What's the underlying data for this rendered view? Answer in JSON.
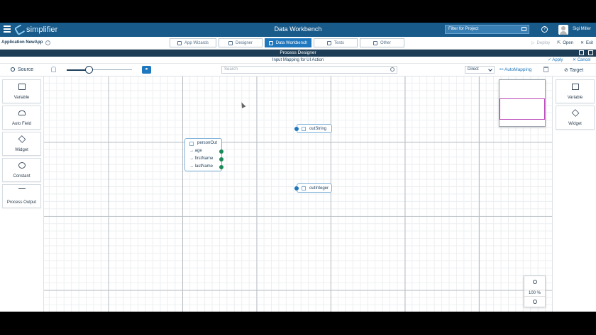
{
  "header": {
    "logo_text": "simplifier",
    "title": "Data Workbench",
    "filter_placeholder": "Filter for Project",
    "user_name": "Sigi Miller",
    "help_symbol": "?",
    "colors": {
      "bar": "#185a8a",
      "accent": "#1f77bd"
    }
  },
  "appbar": {
    "app_name": "Application NewApp",
    "tabs": [
      {
        "label": "App Wizards",
        "icon": "wand-icon"
      },
      {
        "label": "Designer",
        "icon": "edit-icon"
      },
      {
        "label": "Data Workbench",
        "icon": "workbench-icon",
        "active": true
      },
      {
        "label": "Tests",
        "icon": "flask-icon"
      },
      {
        "label": "Other",
        "icon": "window-icon"
      }
    ],
    "deploy_label": "Deploy",
    "open_label": "Open",
    "exit_label": "Exit"
  },
  "designer": {
    "title": "Process Designer",
    "mapping_title": "Input Mapping for UI Action",
    "apply_label": "Apply",
    "cancel_label": "Cancel"
  },
  "toolbar": {
    "source_label": "Source",
    "link_symbol": "⚭",
    "zoom_slider_value": 0.33,
    "search_placeholder": "Search",
    "mode_value": "Direct",
    "automapping_label": "AutoMapping",
    "target_label": "Target"
  },
  "left_panel": [
    {
      "label": "Variable",
      "icon": "variable-icon"
    },
    {
      "label": "Auto Field",
      "icon": "car-icon"
    },
    {
      "label": "Widget",
      "icon": "cube-icon"
    },
    {
      "label": "Constant",
      "icon": "copyright-icon"
    },
    {
      "label": "Process Output",
      "icon": "tree-icon"
    }
  ],
  "right_panel": [
    {
      "label": "Variable",
      "icon": "variable-icon"
    },
    {
      "label": "Widget",
      "icon": "cube-icon"
    }
  ],
  "canvas": {
    "source_node": {
      "title": "personOut",
      "fields": [
        "→ age",
        "→ firstName",
        "→ lastName"
      ]
    },
    "target_nodes": [
      "outString",
      "outInteger"
    ]
  },
  "zoom": {
    "value": "100",
    "unit": "%"
  }
}
